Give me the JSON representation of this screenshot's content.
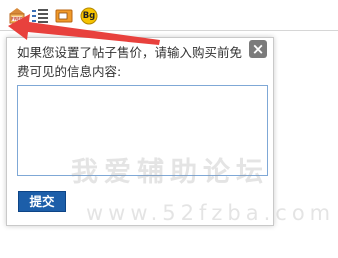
{
  "toolbar": {
    "buttons": [
      {
        "icon": "free-icon"
      },
      {
        "icon": "indent-list-icon"
      },
      {
        "icon": "image-frame-icon"
      },
      {
        "badge_text": "Bg",
        "icon": "bg-badge-icon"
      }
    ]
  },
  "popup": {
    "close_label": "×",
    "prompt": "如果您设置了帖子售价，请输入购买前免费可见的信息内容:",
    "content_value": "",
    "submit_label": "提交"
  },
  "watermark": {
    "text": "我爱辅助论坛",
    "url": "www.52fzba.com"
  },
  "colors": {
    "arrow": "#e8413d",
    "submit_bg": "#1c5ea9",
    "textarea_border": "#7fa8d6",
    "close_bg": "#7b7b7b"
  }
}
